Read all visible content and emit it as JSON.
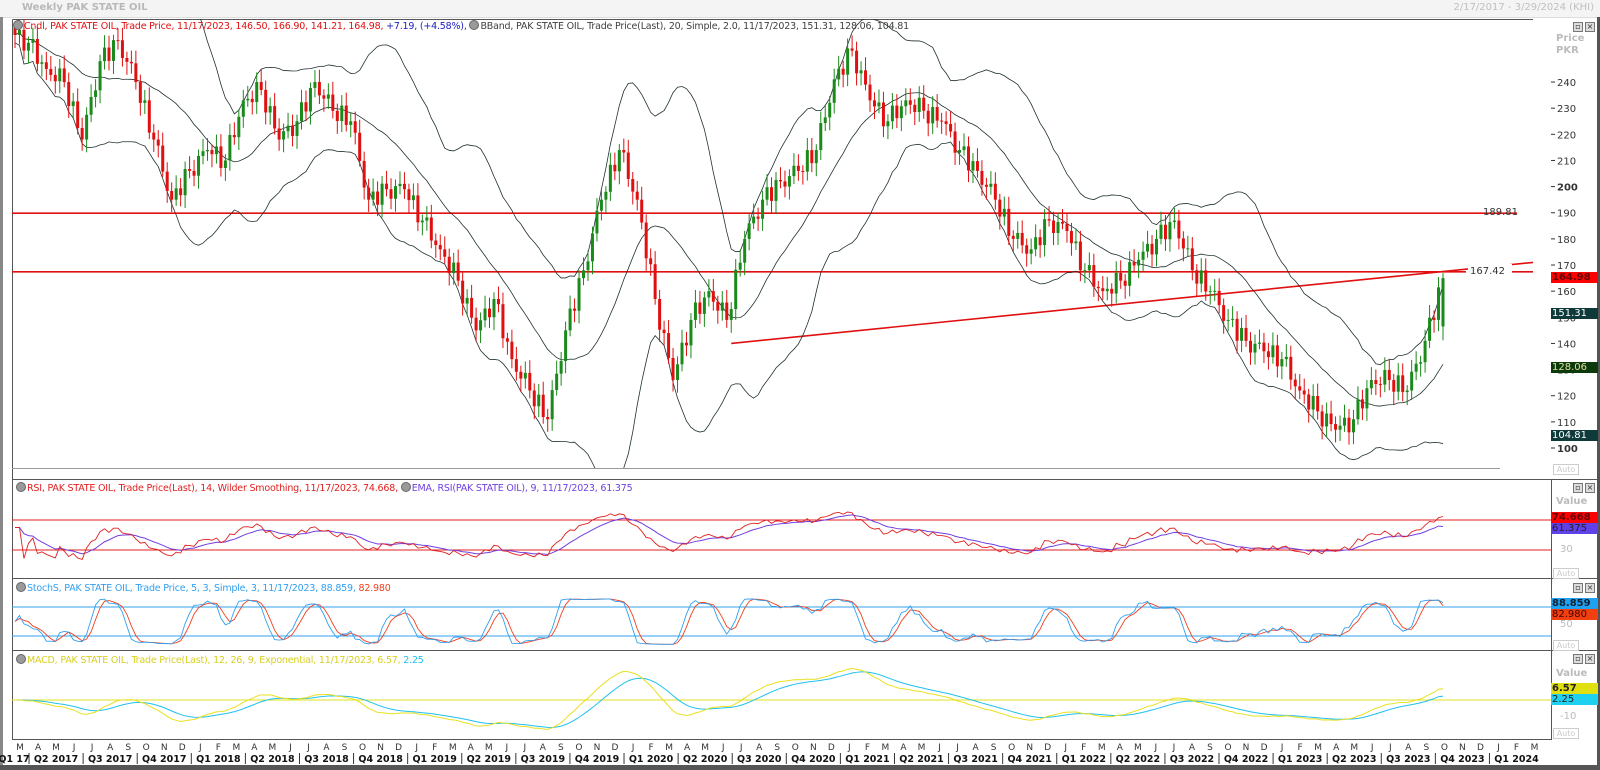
{
  "window": {
    "title": "Weekly PAK STATE OIL",
    "date_range": "2/17/2017 - 3/29/2024 (KHI)"
  },
  "price_pane": {
    "legend_candle": "Cndl, PAK STATE OIL, Trade Price,  11/17/2023, 146.50, 166.90, 141.21, 164.98,",
    "legend_change": "+7.19, (+4.58%),",
    "legend_bband": "BBand, PAK STATE OIL, Trade Price(Last),  20, Simple, 2.0, 11/17/2023, 151.31, 128.06, 104.81",
    "axis_title": "Price",
    "axis_unit": "PKR",
    "auto_label": "Auto",
    "ticks": [
      "240",
      "230",
      "220",
      "210",
      "200",
      "190",
      "180",
      "170",
      "160",
      "150",
      "140",
      "130",
      "120",
      "110",
      "100"
    ],
    "last_close": "164.98",
    "bb_upper": "151.31",
    "bb_mid": "128.06",
    "bb_lower": "104.81",
    "hline_1": "189.81",
    "hline_2": "167.42"
  },
  "rsi_pane": {
    "legend_rsi": "RSI, PAK STATE OIL, Trade Price(Last),  14, Wilder Smoothing,  11/17/2023, 74.668,",
    "legend_ema": "EMA, RSI(PAK STATE OIL),  9,  11/17/2023, 61.375",
    "axis_title": "Value",
    "tick_30": "30",
    "rsi_value": "74.668",
    "ema_value": "61.375",
    "auto_label": "Auto"
  },
  "stoch_pane": {
    "legend_k": "StochS, PAK STATE OIL, Trade Price,  5, 3, Simple, 3, 11/17/2023, 88.859,",
    "legend_d": "82.980",
    "tick_50": "50",
    "k_value": "88.859",
    "d_value": "82.980",
    "auto_label": "Auto"
  },
  "macd_pane": {
    "legend_macd": "MACD, PAK STATE OIL, Trade Price(Last),  12, 26, 9, Exponential,  11/17/2023, 6.57,",
    "legend_signal": "2.25",
    "axis_title": "Value",
    "tick_m10": "-10",
    "macd_value": "6.57",
    "signal_value": "2.25",
    "auto_label": "Auto"
  },
  "x_axis": {
    "months": [
      "M",
      "A",
      "M",
      "J",
      "J",
      "A",
      "S",
      "O",
      "N",
      "D",
      "J",
      "F",
      "M",
      "A",
      "M",
      "J",
      "J",
      "A",
      "S",
      "O",
      "N",
      "D",
      "J",
      "F",
      "M",
      "A",
      "M",
      "J",
      "J",
      "A",
      "S",
      "O",
      "N",
      "D",
      "J",
      "F",
      "M",
      "A",
      "M",
      "J",
      "J",
      "A",
      "S",
      "O",
      "N",
      "D",
      "J",
      "F",
      "M",
      "A",
      "M",
      "J",
      "J",
      "A",
      "S",
      "O",
      "N",
      "D",
      "J",
      "F",
      "M",
      "A",
      "M",
      "J",
      "J",
      "A",
      "S",
      "O",
      "N",
      "D",
      "J",
      "F",
      "M",
      "A",
      "M",
      "J",
      "J",
      "A",
      "S",
      "O",
      "N",
      "D",
      "J",
      "F",
      "M"
    ],
    "quarters": [
      "Q1 17",
      "Q2 2017",
      "Q3 2017",
      "Q4 2017",
      "Q1 2018",
      "Q2 2018",
      "Q3 2018",
      "Q4 2018",
      "Q1 2019",
      "Q2 2019",
      "Q3 2019",
      "Q4 2019",
      "Q1 2020",
      "Q2 2020",
      "Q3 2020",
      "Q4 2020",
      "Q1 2021",
      "Q2 2021",
      "Q3 2021",
      "Q4 2021",
      "Q1 2022",
      "Q2 2022",
      "Q3 2022",
      "Q4 2022",
      "Q1 2023",
      "Q2 2023",
      "Q3 2023",
      "Q4 2023",
      "Q1 2024"
    ]
  },
  "colors": {
    "up": "#1a8a1a",
    "down": "#e01010",
    "rsi": "#e02020",
    "ema": "#7040e0",
    "stoch_k": "#30a0f0",
    "stoch_d": "#f04020",
    "macd": "#e8e020",
    "signal": "#20c0f0",
    "band": "#203030"
  },
  "chart_data": {
    "type": "candlestick",
    "period": "weekly",
    "monthly_closes_from": "Mar 2017",
    "monthly_closes": [
      255,
      245,
      240,
      218,
      248,
      256,
      240,
      218,
      195,
      206,
      214,
      210,
      233,
      237,
      218,
      225,
      240,
      229,
      225,
      195,
      199,
      199,
      187,
      176,
      164,
      145,
      157,
      134,
      122,
      111,
      145,
      168,
      195,
      214,
      195,
      157,
      126,
      149,
      160,
      149,
      180,
      195,
      202,
      206,
      214,
      241,
      252,
      233,
      225,
      233,
      229,
      225,
      214,
      206,
      195,
      180,
      176,
      187,
      183,
      168,
      160,
      164,
      172,
      180,
      187,
      168,
      160,
      149,
      141,
      137,
      134,
      122,
      114,
      107,
      111,
      126,
      126,
      122,
      141,
      164.98
    ],
    "last_candle": {
      "date": "11/17/2023",
      "open": 146.5,
      "high": 166.9,
      "low": 141.21,
      "close": 164.98,
      "change": 7.19,
      "change_pct": 4.58
    },
    "bollinger_last": {
      "upper": 151.31,
      "middle": 128.06,
      "lower": 104.81
    },
    "horizontal_lines": [
      189.81,
      167.42
    ],
    "trendline": {
      "from": {
        "date": "Jul 2020",
        "price": 140
      },
      "to": {
        "date": "Mar 2024",
        "price": 171
      }
    },
    "y_range": [
      95,
      265
    ],
    "rsi_levels": [
      70,
      30
    ],
    "stoch_levels": [
      80,
      20
    ]
  }
}
